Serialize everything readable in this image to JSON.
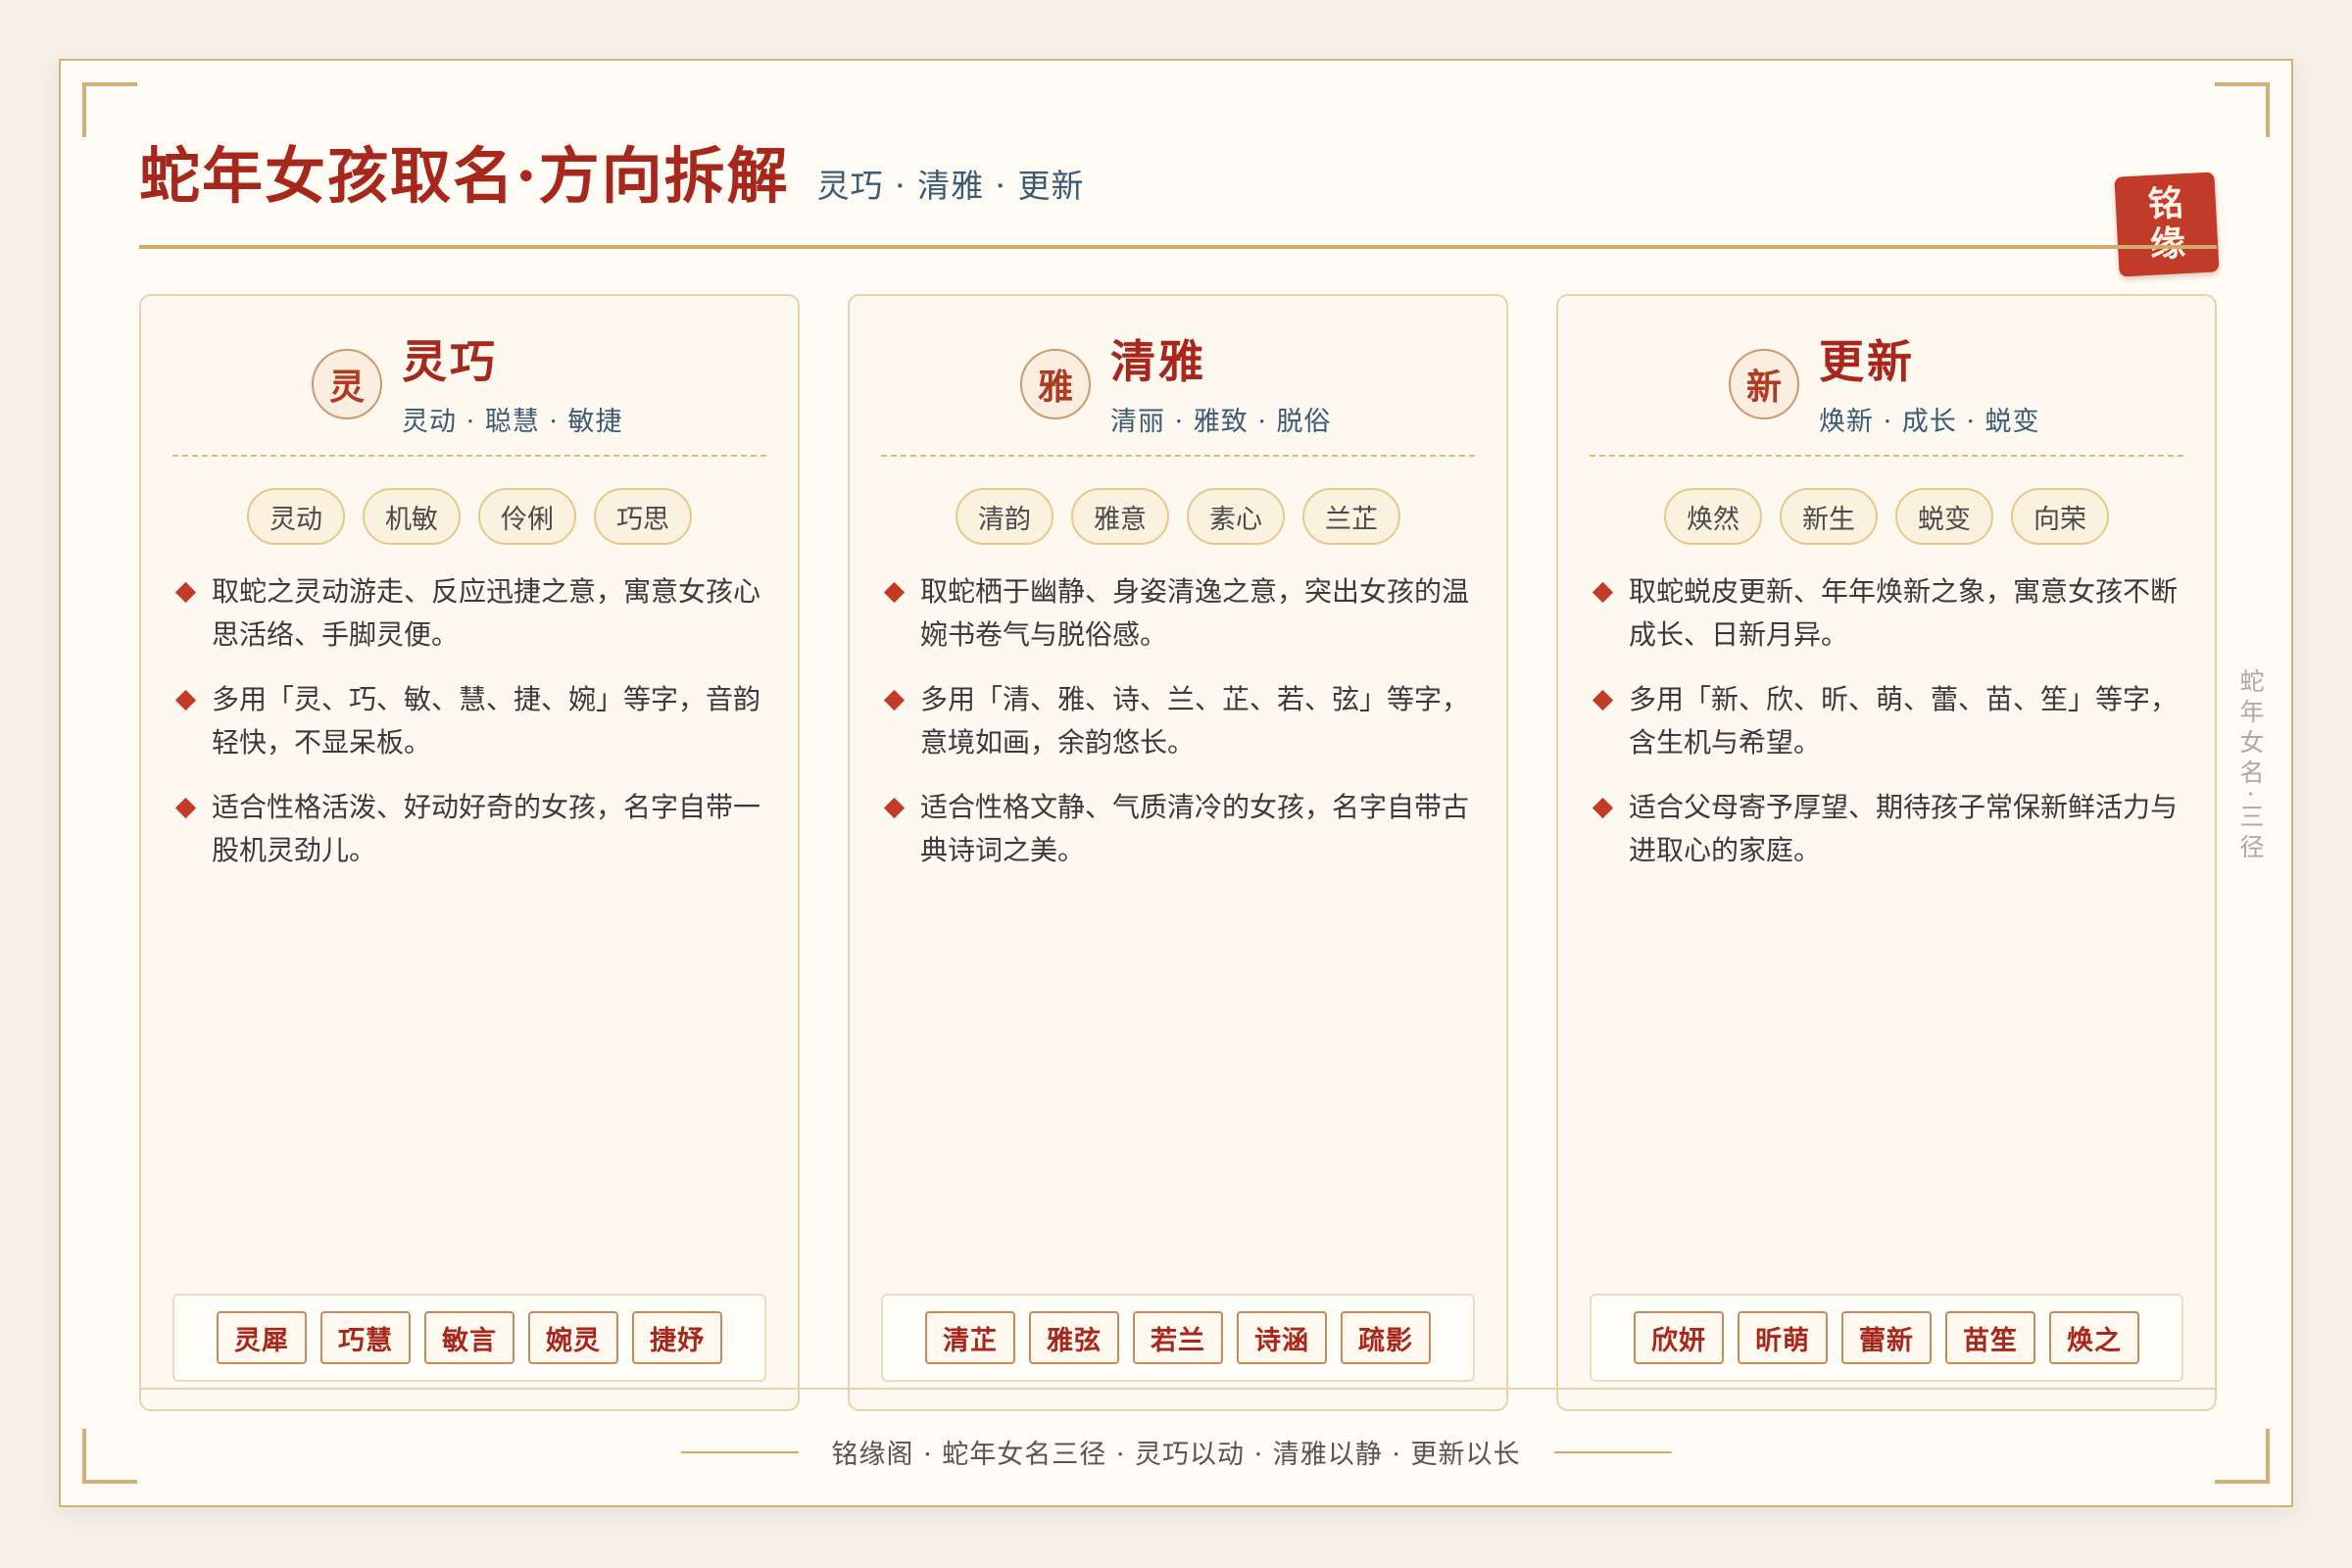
{
  "header": {
    "title": "蛇年女孩取名·方向拆解",
    "subtitle": "灵巧 · 清雅 · 更新",
    "seal_top": "铭",
    "seal_bottom": "缘"
  },
  "cards": [
    {
      "badge": "灵",
      "title": "灵巧",
      "subtitle": "灵动 · 聪慧 · 敏捷",
      "tags": [
        "灵动",
        "机敏",
        "伶俐",
        "巧思"
      ],
      "points": [
        "取蛇之灵动游走、反应迅捷之意，寓意女孩心思活络、手脚灵便。",
        "多用「灵、巧、敏、慧、捷、婉」等字，音韵轻快，不显呆板。",
        "适合性格活泼、好动好奇的女孩，名字自带一股机灵劲儿。"
      ],
      "names": [
        "灵犀",
        "巧慧",
        "敏言",
        "婉灵",
        "捷妤"
      ]
    },
    {
      "badge": "雅",
      "title": "清雅",
      "subtitle": "清丽 · 雅致 · 脱俗",
      "tags": [
        "清韵",
        "雅意",
        "素心",
        "兰芷"
      ],
      "points": [
        "取蛇栖于幽静、身姿清逸之意，突出女孩的温婉书卷气与脱俗感。",
        "多用「清、雅、诗、兰、芷、若、弦」等字，意境如画，余韵悠长。",
        "适合性格文静、气质清冷的女孩，名字自带古典诗词之美。"
      ],
      "names": [
        "清芷",
        "雅弦",
        "若兰",
        "诗涵",
        "疏影"
      ]
    },
    {
      "badge": "新",
      "title": "更新",
      "subtitle": "焕新 · 成长 · 蜕变",
      "tags": [
        "焕然",
        "新生",
        "蜕变",
        "向荣"
      ],
      "points": [
        "取蛇蜕皮更新、年年焕新之象，寓意女孩不断成长、日新月异。",
        "多用「新、欣、昕、萌、蕾、苗、笙」等字，含生机与希望。",
        "适合父母寄予厚望、期待孩子常保新鲜活力与进取心的家庭。"
      ],
      "names": [
        "欣妍",
        "昕萌",
        "蕾新",
        "苗笙",
        "焕之"
      ]
    }
  ],
  "side_note": "蛇年女名·三径",
  "footer": {
    "text": "铭缘阁 · 蛇年女名三径 · 灵巧以动 · 清雅以静 · 更新以长"
  },
  "colors": {
    "title_red": "#a8271c",
    "seal_red": "#c23a28",
    "gold": "#d2aa6a",
    "subtitle_blue": "#3b5a74",
    "paper": "#fdfbf4"
  }
}
